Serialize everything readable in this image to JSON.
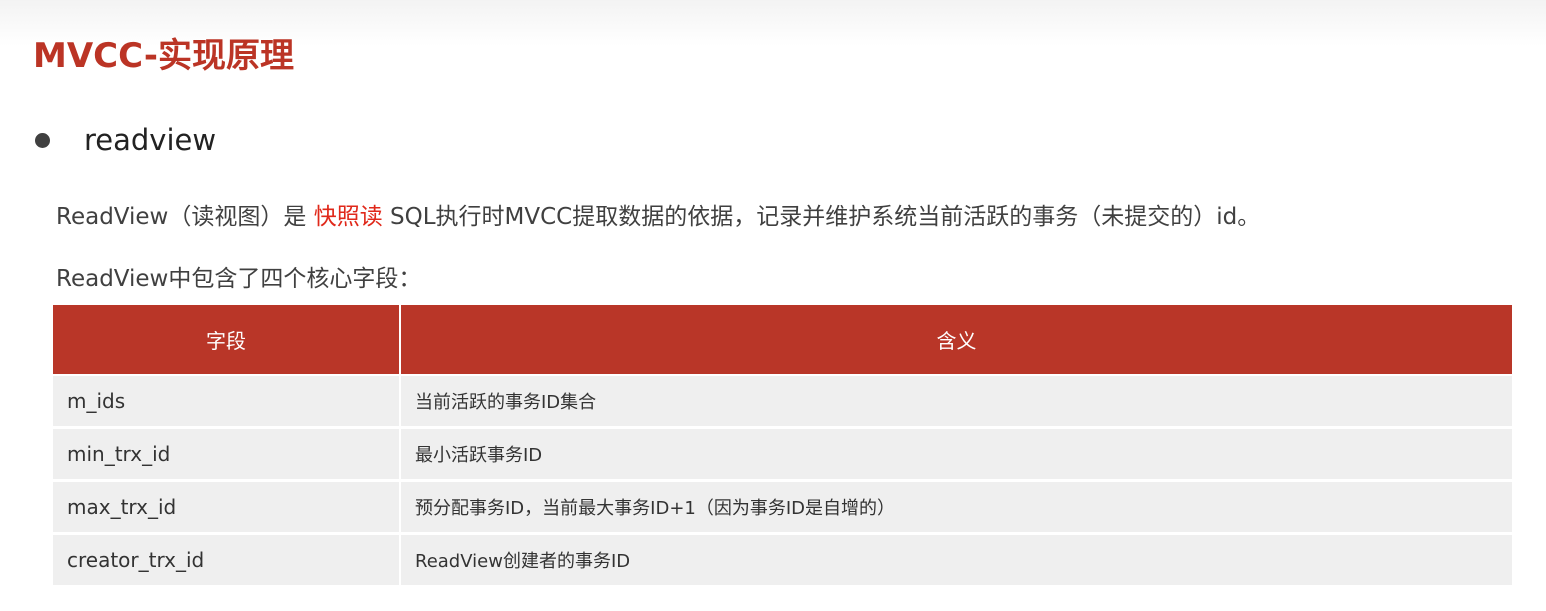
{
  "title": "MVCC-实现原理",
  "bullet": {
    "text": "readview"
  },
  "paragraph1": {
    "before": "ReadView（读视图）是 ",
    "highlight": "快照读",
    "after": " SQL执行时MVCC提取数据的依据，记录并维护系统当前活跃的事务（未提交的）id。"
  },
  "paragraph2": "ReadView中包含了四个核心字段：",
  "table": {
    "headers": [
      "字段",
      "含义"
    ],
    "rows": [
      [
        "m_ids",
        "当前活跃的事务ID集合"
      ],
      [
        "min_trx_id",
        "最小活跃事务ID"
      ],
      [
        "max_trx_id",
        "预分配事务ID，当前最大事务ID+1（因为事务ID是自增的）"
      ],
      [
        "creator_trx_id",
        "ReadView创建者的事务ID"
      ]
    ]
  },
  "colors": {
    "accent": "#bb3425",
    "highlight": "#e0281a",
    "header_bg": "#b93628",
    "row_bg": "#efefef"
  }
}
